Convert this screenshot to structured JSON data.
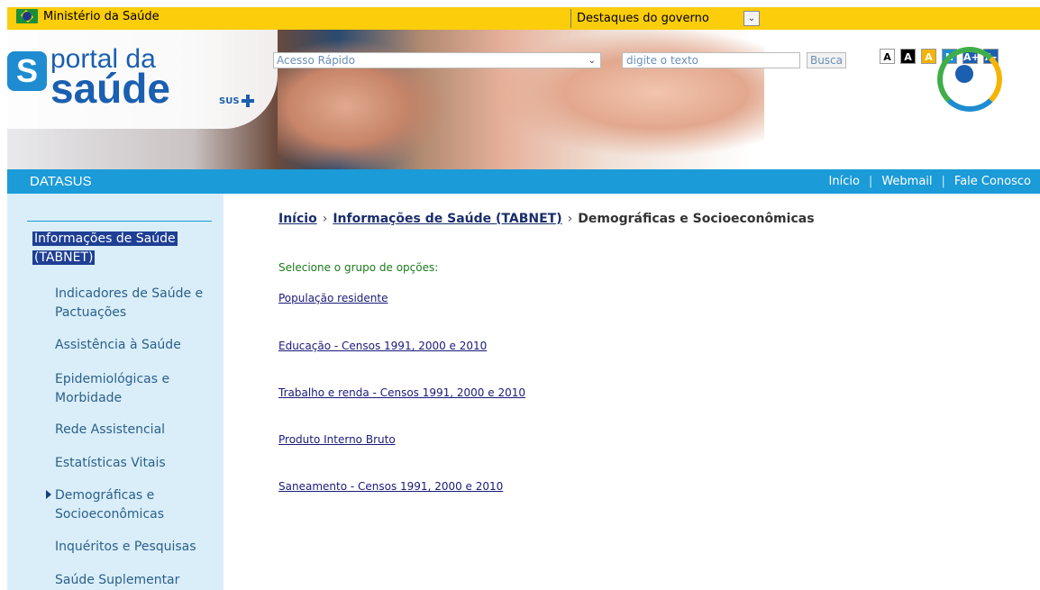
{
  "gov": {
    "brand": "Ministério da Saúde",
    "destaques": "Destaques do governo"
  },
  "header": {
    "logo_line1": "portal da",
    "logo_line2": "saúde",
    "logo_sus": "SUS",
    "acesso_rapido": "Acesso Rápido",
    "search_placeholder": "digite o texto",
    "busca": "Busca",
    "a11y": [
      "A",
      "A",
      "A",
      "N",
      "A+",
      "A-"
    ]
  },
  "bluebar": {
    "section": "DATASUS",
    "links": [
      "Início",
      "Webmail",
      "Fale Conosco"
    ],
    "separator": "|"
  },
  "sidebar": {
    "heading_line1": "Informações de Saúde",
    "heading_line2": "(TABNET)",
    "items": [
      {
        "l1": "Indicadores de Saúde e",
        "l2": "Pactuações"
      },
      {
        "l1": "Assistência à Saúde",
        "l2": ""
      },
      {
        "l1": "Epidemiológicas e",
        "l2": "Morbidade"
      },
      {
        "l1": "Rede Assistencial",
        "l2": ""
      },
      {
        "l1": "Estatísticas Vitais",
        "l2": ""
      },
      {
        "l1": "Demográficas e",
        "l2": "Socioeconômicas"
      },
      {
        "l1": "Inquéritos e Pesquisas",
        "l2": ""
      },
      {
        "l1": "Saúde Suplementar",
        "l2": ""
      }
    ]
  },
  "main": {
    "breadcrumb": [
      "Início",
      "Informações de Saúde (TABNET)",
      "Demográficas e Socioeconômicas"
    ],
    "breadcrumb_sep": "›",
    "prompt": "Selecione o grupo de opções:",
    "links": [
      "População residente",
      "Educação - Censos 1991, 2000 e 2010",
      "Trabalho e renda - Censos 1991, 2000 e 2010",
      "Produto Interno Bruto",
      "Saneamento - Censos 1991, 2000 e 2010"
    ]
  },
  "colors": {
    "gov_yellow": "#fbcd0a",
    "datasus_blue": "#1b9bd8",
    "sidebar_bg": "#d9eef8",
    "active_bg": "#1e3f94",
    "prompt_green": "#1a7a1a"
  }
}
